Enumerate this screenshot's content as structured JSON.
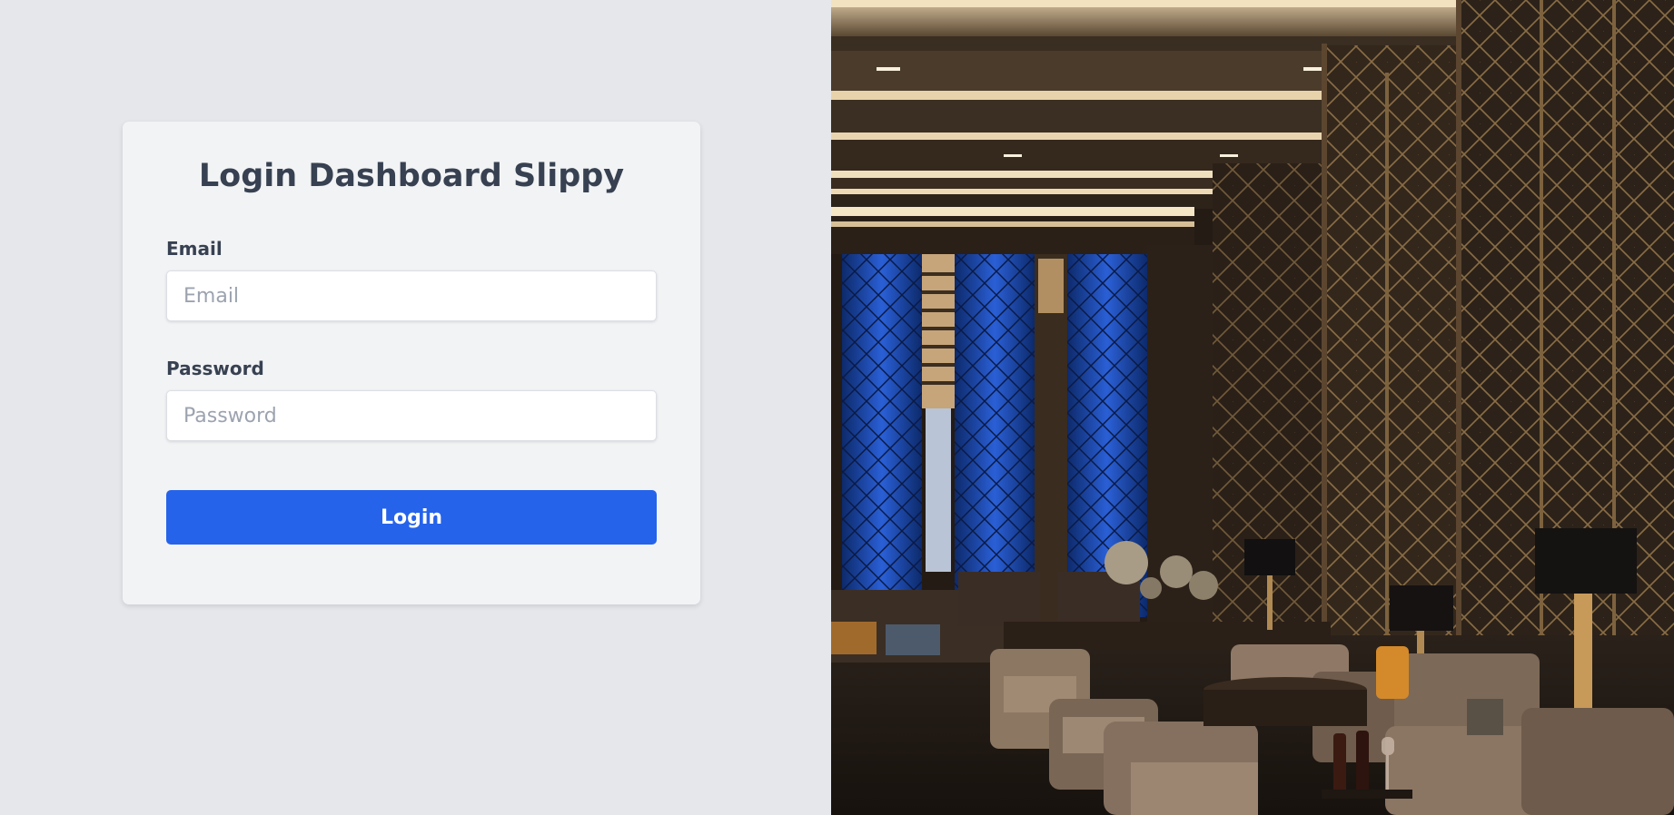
{
  "login_card": {
    "title": "Login Dashboard Slippy",
    "email": {
      "label": "Email",
      "placeholder": "Email",
      "value": ""
    },
    "password": {
      "label": "Password",
      "placeholder": "Password",
      "value": ""
    },
    "submit_label": "Login"
  },
  "colors": {
    "page_background": "#e5e7eb",
    "card_background": "#f2f3f5",
    "text_primary": "#374151",
    "placeholder": "#9ca3af",
    "button_primary": "#2563eb"
  },
  "photo": {
    "subject": "lounge-interior-photo"
  }
}
